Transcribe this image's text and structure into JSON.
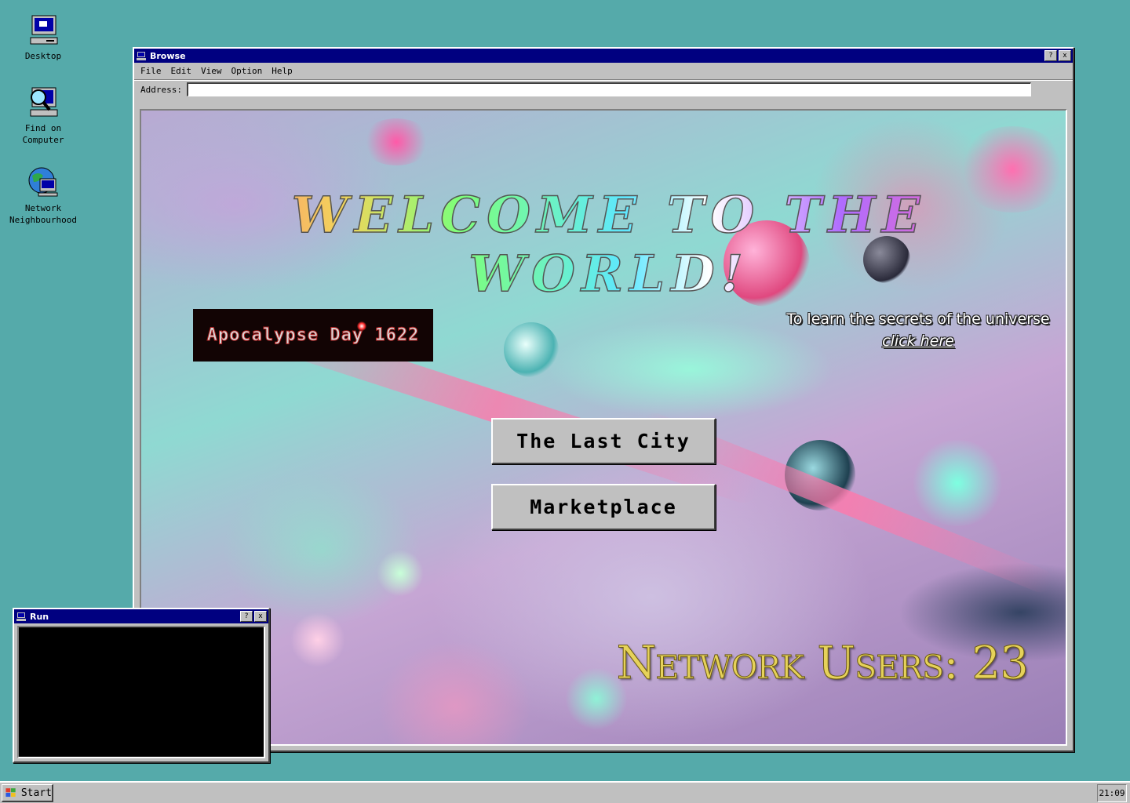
{
  "desktop": {
    "icons": [
      {
        "label": "Desktop",
        "icon": "computer-icon"
      },
      {
        "label": "Find on\nComputer",
        "icon": "search-computer-icon"
      },
      {
        "label": "Network\nNeighbourhood",
        "icon": "network-globe-icon"
      }
    ]
  },
  "browse_window": {
    "title": "Browse",
    "help_button": "?",
    "close_button": "x",
    "menu": [
      "File",
      "Edit",
      "View",
      "Option",
      "Help"
    ],
    "address_label": "Address:",
    "address_value": "",
    "page": {
      "welcome_heading": "Welcome to the World!",
      "banner_text": "Apocalypse Day 1622",
      "secrets_text": "To learn the secrets of the universe",
      "secrets_link": "click here",
      "buttons": [
        "The Last City",
        "Marketplace"
      ],
      "network_users_label": "Network Users:",
      "network_users_count": "23"
    }
  },
  "run_window": {
    "title": "Run",
    "help_button": "?",
    "close_button": "x"
  },
  "taskbar": {
    "start_label": "Start",
    "clock": "21:09"
  },
  "colors": {
    "desktop": "#55aaaa",
    "titlebar": "#000080",
    "chrome": "#c0c0c0"
  }
}
